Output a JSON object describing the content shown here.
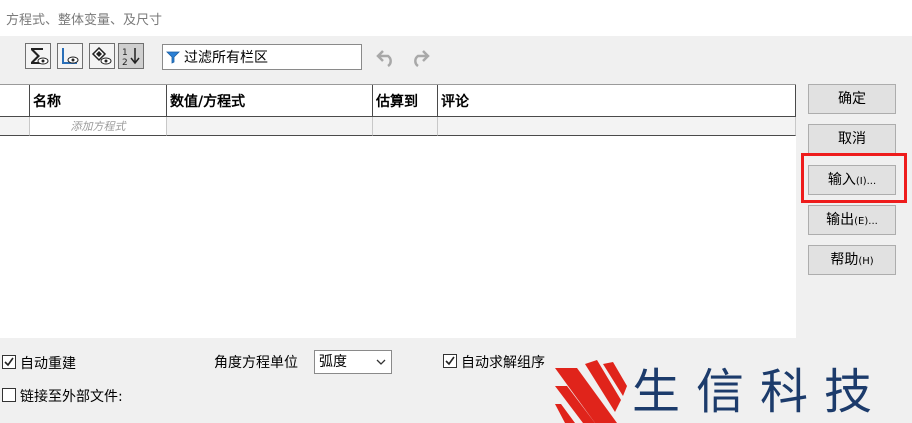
{
  "window": {
    "title": "方程式、整体变量、及尺寸"
  },
  "toolbar": {
    "filter_text": "过滤所有栏区"
  },
  "table": {
    "columns": [
      "名称",
      "数值/方程式",
      "估算到",
      "评论"
    ],
    "add_placeholder": "添加方程式"
  },
  "buttons": {
    "ok": "确定",
    "cancel": "取消",
    "import": "输入",
    "import_key": "(I)...",
    "export": "输出",
    "export_key": "(E)...",
    "help": "帮助",
    "help_key": "(H)"
  },
  "options": {
    "auto_rebuild": "自动重建",
    "auto_rebuild_checked": true,
    "angle_unit_label": "角度方程单位",
    "angle_unit_value": "弧度",
    "auto_solve_order": "自动求解组序",
    "auto_solve_order_checked": true,
    "link_external": "链接至外部文件:",
    "link_external_checked": false
  },
  "watermark": {
    "text": "生信科技"
  },
  "colors": {
    "highlight": "#ee1c1c",
    "logo_blue": "#1c3b6b",
    "logo_red": "#e0241b"
  }
}
